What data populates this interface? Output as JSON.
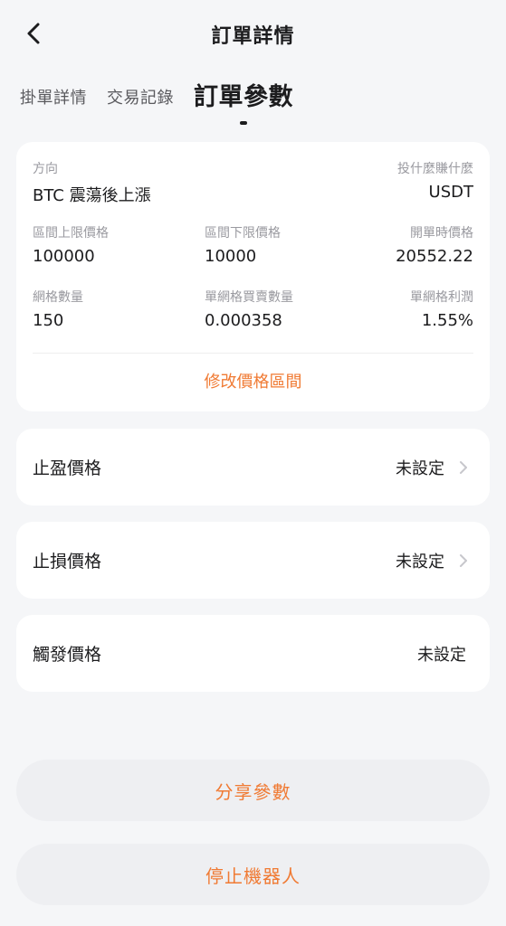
{
  "header": {
    "title": "訂單詳情"
  },
  "tabs": [
    {
      "label": "掛單詳情"
    },
    {
      "label": "交易記錄"
    },
    {
      "label": "訂單參數"
    }
  ],
  "info": {
    "direction_label": "方向",
    "direction_value": "BTC 震蕩後上漲",
    "invest_label": "投什麼賺什麼",
    "invest_value": "USDT",
    "upper_label": "區間上限價格",
    "upper_value": "100000",
    "lower_label": "區間下限價格",
    "lower_value": "10000",
    "open_label": "開單時價格",
    "open_value": "20552.22",
    "grid_count_label": "網格數量",
    "grid_count_value": "150",
    "per_grid_qty_label": "單網格買賣數量",
    "per_grid_qty_value": "0.000358",
    "per_grid_profit_label": "單網格利潤",
    "per_grid_profit_value": "1.55%",
    "modify_label": "修改價格區間"
  },
  "take_profit": {
    "label": "止盈價格",
    "value": "未設定"
  },
  "stop_loss": {
    "label": "止損價格",
    "value": "未設定"
  },
  "trigger": {
    "label": "觸發價格",
    "value": "未設定"
  },
  "buttons": {
    "share": "分享參數",
    "stop": "停止機器人"
  },
  "colors": {
    "accent": "#f07a33",
    "background": "#f5f6f8"
  },
  "icons": {
    "back": "chevron-left-icon",
    "row_arrow": "chevron-right-icon"
  }
}
